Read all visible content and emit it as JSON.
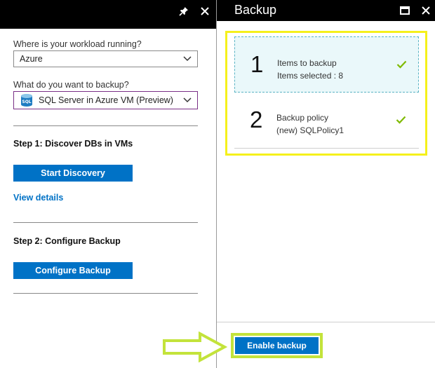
{
  "left_blade": {
    "workload_label": "Where is your workload running?",
    "workload_value": "Azure",
    "backup_label": "What do you want to backup?",
    "backup_value": "SQL Server in Azure VM (Preview)",
    "backup_icon_text": "SQL",
    "step1_title": "Step 1: Discover DBs in VMs",
    "start_discovery_label": "Start Discovery",
    "view_details_label": "View details",
    "step2_title": "Step 2: Configure Backup",
    "configure_backup_label": "Configure Backup"
  },
  "right_blade": {
    "title": "Backup",
    "steps": [
      {
        "number": "1",
        "title": "Items to backup",
        "detail": "Items selected : 8",
        "status_icon": "checkmark-icon"
      },
      {
        "number": "2",
        "title": "Backup policy",
        "detail": "(new) SQLPolicy1",
        "status_icon": "checkmark-icon"
      }
    ],
    "enable_backup_label": "Enable backup"
  },
  "icons": {
    "pin": "pin-icon",
    "close": "close-icon",
    "maximize": "maximize-icon",
    "chevron": "chevron-down-icon",
    "sql_db": "sql-database-icon",
    "arrow": "arrow-right-icon"
  },
  "colors": {
    "header_bg": "#000000",
    "accent_blue": "#0072c6",
    "highlight_yellow": "#f5f01b",
    "highlight_green": "#c3e33b",
    "check_green": "#7fba00",
    "selected_step_bg": "#eaf8fa"
  }
}
